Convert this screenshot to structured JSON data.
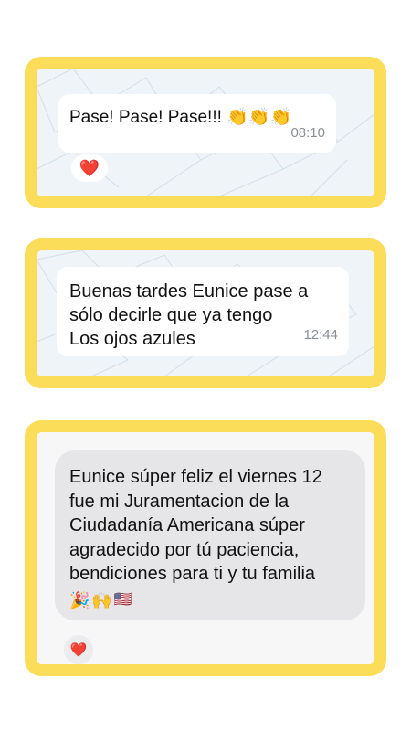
{
  "cards": [
    {
      "message": "Pase! Pase! Pase!!! 👏👏👏",
      "time": "08:10",
      "reaction": "❤️"
    },
    {
      "lines": [
        "Buenas tardes Eunice pase a",
        "sólo decirle que ya tengo",
        "Los ojos azules"
      ],
      "time": "12:44"
    },
    {
      "lines": [
        "Eunice súper feliz el viernes 12",
        "fue mi Juramentacion de la",
        "Ciudadanía Americana súper",
        "agradecido por tú paciencia,",
        "bendiciones para ti y tu familia"
      ],
      "emojis": [
        "🎉",
        "🙌",
        "🇺🇸"
      ],
      "reaction": "❤️"
    }
  ],
  "colors": {
    "highlight": "#FCDD5A",
    "chat_background": "#EEF4F8",
    "bubble": "#FFFFFF",
    "dm_bubble": "#E6E6E8",
    "heart": "#E8212C"
  },
  "icons": [
    "clapping-hands-emoji",
    "heart-reaction-icon",
    "party-popper-emoji",
    "raised-hands-emoji",
    "us-flag-emoji"
  ]
}
